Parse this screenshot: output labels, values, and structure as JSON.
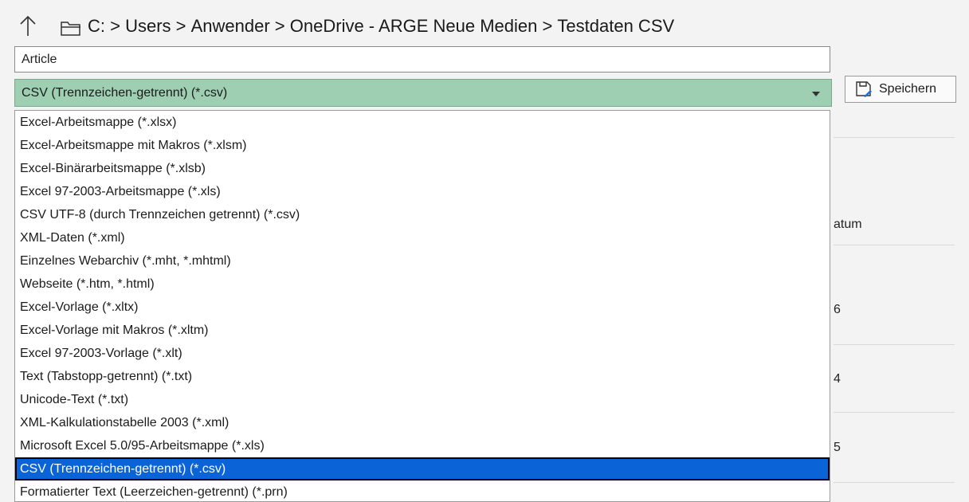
{
  "breadcrumb": {
    "items": [
      "C:",
      "Users",
      "Anwender",
      "OneDrive - ARGE Neue Medien",
      "Testdaten CSV"
    ],
    "separator": ">"
  },
  "filename": {
    "value": "Article"
  },
  "filetype": {
    "selected": "CSV (Trennzeichen-getrennt) (*.csv)",
    "options": [
      "Excel-Arbeitsmappe (*.xlsx)",
      "Excel-Arbeitsmappe mit Makros (*.xlsm)",
      "Excel-Binärarbeitsmappe (*.xlsb)",
      "Excel 97-2003-Arbeitsmappe (*.xls)",
      "CSV UTF-8 (durch Trennzeichen getrennt) (*.csv)",
      "XML-Daten (*.xml)",
      "Einzelnes Webarchiv (*.mht, *.mhtml)",
      "Webseite (*.htm, *.html)",
      "Excel-Vorlage (*.xltx)",
      "Excel-Vorlage mit Makros (*.xltm)",
      "Excel 97-2003-Vorlage (*.xlt)",
      "Text (Tabstopp-getrennt) (*.txt)",
      "Unicode-Text (*.txt)",
      "XML-Kalkulationstabelle 2003 (*.xml)",
      "Microsoft Excel 5.0/95-Arbeitsmappe (*.xls)",
      "CSV (Trennzeichen-getrennt) (*.csv)",
      "Formatierter Text (Leerzeichen-getrennt) (*.prn)"
    ],
    "highlighted_index": 15
  },
  "save_button": {
    "label": "Speichern",
    "icon": "save-icon"
  },
  "background": {
    "column_header_fragment": "atum",
    "row_fragments": [
      "6",
      "4",
      "5"
    ]
  },
  "colors": {
    "select_bg": "#9ecfb2",
    "highlight": "#0a64d8"
  }
}
